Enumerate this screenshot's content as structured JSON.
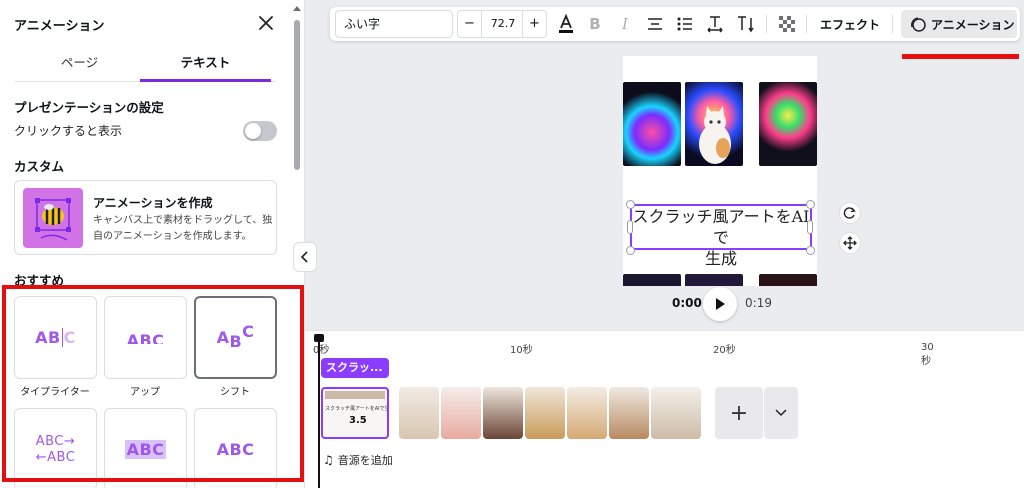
{
  "panel": {
    "title": "アニメーション",
    "tabs": [
      "ページ",
      "テキスト"
    ],
    "presentation_heading": "プレゼンテーションの設定",
    "click_to_show": "クリックすると表示",
    "custom_heading": "カスタム",
    "custom_card": {
      "title": "アニメーションを作成",
      "description": "キャンバス上で素材をドラッグして、独自のアニメーションを作成します。"
    },
    "recommended_heading": "おすすめ",
    "animations": [
      {
        "label": "タイプライター",
        "preview": "ABC"
      },
      {
        "label": "アップ",
        "preview": "ABC"
      },
      {
        "label": "シフト",
        "preview": "ABC"
      },
      {
        "label": "",
        "preview": "ABC→\n←ABC"
      },
      {
        "label": "",
        "preview": "ABC"
      },
      {
        "label": "",
        "preview": "ABC"
      }
    ]
  },
  "toolbar": {
    "font": "ふい字",
    "minus": "−",
    "size": "72.7",
    "plus": "+",
    "effects": "エフェクト",
    "animate": "アニメーション"
  },
  "canvas": {
    "title_line1": "スクラッチ風アートをAIで",
    "title_line2": "生成"
  },
  "player": {
    "current": "0:00",
    "total": "0:19"
  },
  "timeline": {
    "ticks": [
      "0秒",
      "10秒",
      "20秒",
      "30\n秒"
    ],
    "text_clip": "スクラッ...",
    "first_thumb_title": "スクラッチ風アートをAIで生成",
    "first_thumb_num": "3.5",
    "add_audio": "音源を追加",
    "add_page": "+"
  },
  "colors": {
    "accent": "#8b3dff",
    "highlight": "#e3100f"
  }
}
